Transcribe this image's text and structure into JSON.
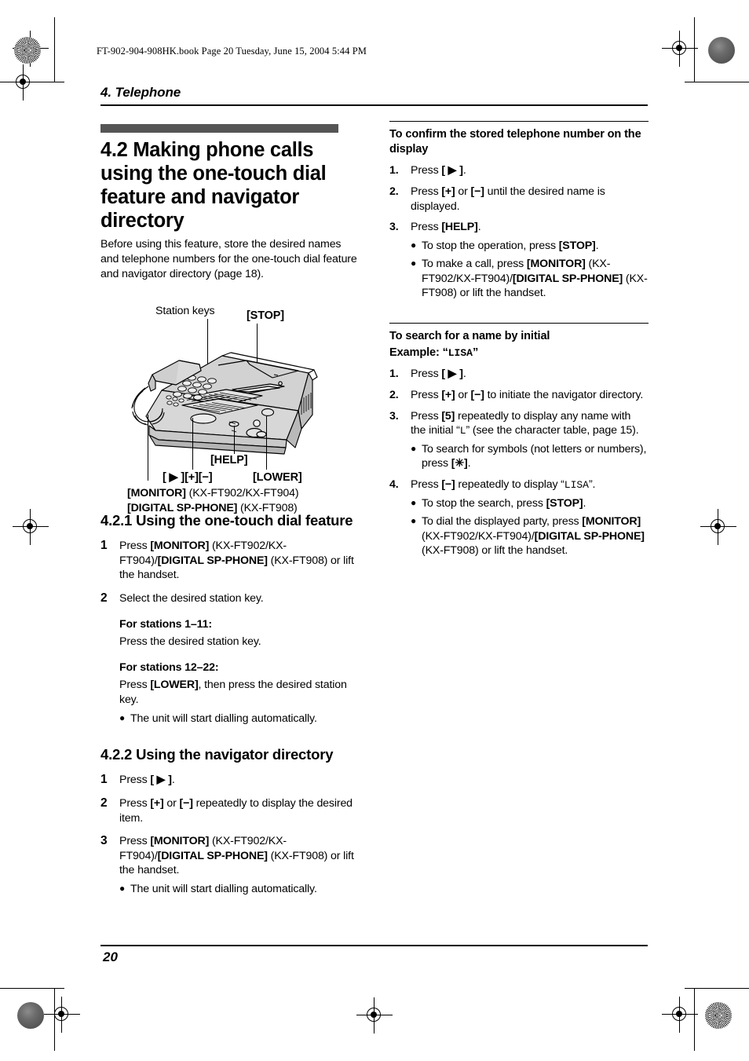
{
  "printer_marks": {
    "file_stamp": "FT-902-904-908HK.book  Page 20  Tuesday, June 15, 2004  5:44 PM"
  },
  "header": {
    "chapter": "4. Telephone"
  },
  "footer": {
    "page_number": "20"
  },
  "colors": {
    "section_band": "#555555",
    "rule": "#000000",
    "phone_body": "#d8d8d8",
    "phone_shadow": "#a9a9a9"
  },
  "left_column": {
    "section_title": "4.2 Making phone calls using the one-touch dial feature and navigator directory",
    "intro": "Before using this feature, store the desired names and telephone numbers for the one-touch dial feature and navigator directory (page 18).",
    "figure": {
      "label_station_keys": "Station keys",
      "label_stop": "[STOP]",
      "label_help": "[HELP]",
      "label_keys_row": "[ ▶ ][+][−]",
      "label_lower": "[LOWER]",
      "label_monitor_key": "[MONITOR]",
      "label_monitor_models": " (KX-FT902/KX-FT904)",
      "label_spphone_key": "[DIGITAL SP-PHONE]",
      "label_spphone_models": " (KX-FT908)"
    },
    "subsection_1": {
      "title": "4.2.1 Using the one-touch dial feature",
      "steps": [
        {
          "num": "1",
          "parts": [
            {
              "t": "Press ",
              "b": false
            },
            {
              "t": "[MONITOR]",
              "b": true
            },
            {
              "t": " (KX-FT902/KX-FT904)/",
              "b": false
            },
            {
              "t": "[DIGITAL SP-PHONE]",
              "b": true
            },
            {
              "t": " (KX-FT908) or lift the handset.",
              "b": false
            }
          ]
        },
        {
          "num": "2",
          "parts": [
            {
              "t": "Select the desired station key.",
              "b": false
            }
          ]
        }
      ],
      "stations_1_head": "For stations 1–11:",
      "stations_1_body": "Press the desired station key.",
      "stations_2_head": "For stations 12–22:",
      "stations_2_body_parts": [
        {
          "t": "Press ",
          "b": false
        },
        {
          "t": "[LOWER]",
          "b": true
        },
        {
          "t": ", then press the desired station key.",
          "b": false
        }
      ],
      "bullet": "The unit will start dialling automatically."
    },
    "subsection_2": {
      "title": "4.2.2 Using the navigator directory",
      "steps": [
        {
          "num": "1",
          "parts": [
            {
              "t": "Press ",
              "b": false
            },
            {
              "t": "[ ▶ ]",
              "b": true
            },
            {
              "t": ".",
              "b": false
            }
          ]
        },
        {
          "num": "2",
          "parts": [
            {
              "t": "Press ",
              "b": false
            },
            {
              "t": "[+]",
              "b": true
            },
            {
              "t": " or ",
              "b": false
            },
            {
              "t": "[−]",
              "b": true
            },
            {
              "t": " repeatedly to display the desired item.",
              "b": false
            }
          ]
        },
        {
          "num": "3",
          "parts": [
            {
              "t": "Press ",
              "b": false
            },
            {
              "t": "[MONITOR]",
              "b": true
            },
            {
              "t": " (KX-FT902/KX-FT904)/",
              "b": false
            },
            {
              "t": "[DIGITAL SP-PHONE]",
              "b": true
            },
            {
              "t": " (KX-FT908) or lift the handset.",
              "b": false
            }
          ]
        }
      ],
      "bullet": "The unit will start dialling automatically."
    }
  },
  "right_column": {
    "block_1": {
      "heading": "To confirm the stored telephone number on the display",
      "steps": [
        {
          "num": "1.",
          "parts": [
            {
              "t": "Press ",
              "b": false
            },
            {
              "t": "[ ▶ ]",
              "b": true
            },
            {
              "t": ".",
              "b": false
            }
          ],
          "bullets": []
        },
        {
          "num": "2.",
          "parts": [
            {
              "t": "Press ",
              "b": false
            },
            {
              "t": "[+]",
              "b": true
            },
            {
              "t": " or ",
              "b": false
            },
            {
              "t": "[−]",
              "b": true
            },
            {
              "t": " until the desired name is displayed.",
              "b": false
            }
          ],
          "bullets": []
        },
        {
          "num": "3.",
          "parts": [
            {
              "t": "Press ",
              "b": false
            },
            {
              "t": "[HELP]",
              "b": true
            },
            {
              "t": ".",
              "b": false
            }
          ],
          "bullets": [
            [
              {
                "t": "To stop the operation, press ",
                "b": false
              },
              {
                "t": "[STOP]",
                "b": true
              },
              {
                "t": ".",
                "b": false
              }
            ],
            [
              {
                "t": "To make a call, press ",
                "b": false
              },
              {
                "t": "[MONITOR]",
                "b": true
              },
              {
                "t": " (KX-FT902/KX-FT904)/",
                "b": false
              },
              {
                "t": "[DIGITAL SP-PHONE]",
                "b": true
              },
              {
                "t": " (KX-FT908) or lift the handset.",
                "b": false
              }
            ]
          ]
        }
      ]
    },
    "block_2": {
      "heading": "To search for a name by initial",
      "example_label": "Example: “",
      "example_value": "LISA",
      "example_close": "”",
      "steps": [
        {
          "num": "1.",
          "parts": [
            {
              "t": "Press ",
              "b": false
            },
            {
              "t": "[ ▶ ]",
              "b": true
            },
            {
              "t": ".",
              "b": false
            }
          ],
          "bullets": []
        },
        {
          "num": "2.",
          "parts": [
            {
              "t": "Press ",
              "b": false
            },
            {
              "t": "[+]",
              "b": true
            },
            {
              "t": " or ",
              "b": false
            },
            {
              "t": "[−]",
              "b": true
            },
            {
              "t": " to initiate the navigator directory.",
              "b": false
            }
          ],
          "bullets": []
        },
        {
          "num": "3.",
          "parts": [
            {
              "t": "Press ",
              "b": true,
              "only": "[5]"
            },
            {
              "t": "Press ",
              "b": false
            },
            {
              "t": "[5]",
              "b": true
            },
            {
              "t": " repeatedly to display any name with the initial “",
              "b": false
            },
            {
              "t": "L",
              "mono": true
            },
            {
              "t": "” (see the character table, page 15).",
              "b": false
            }
          ],
          "bullets": [
            [
              {
                "t": "To search for symbols (not letters or numbers), press ",
                "b": false
              },
              {
                "t": "[✳]",
                "b": true
              },
              {
                "t": ".",
                "b": false
              }
            ]
          ]
        },
        {
          "num": "4.",
          "parts": [
            {
              "t": "Press ",
              "b": false
            },
            {
              "t": "[−]",
              "b": true
            },
            {
              "t": " repeatedly to display “",
              "b": false
            },
            {
              "t": "LISA",
              "mono": true
            },
            {
              "t": "”.",
              "b": false
            }
          ],
          "bullets": [
            [
              {
                "t": "To stop the search, press ",
                "b": false
              },
              {
                "t": "[STOP]",
                "b": true
              },
              {
                "t": ".",
                "b": false
              }
            ],
            [
              {
                "t": "To dial the displayed party, press ",
                "b": false
              },
              {
                "t": "[MONITOR]",
                "b": true
              },
              {
                "t": " (KX-FT902/KX-FT904)/",
                "b": false
              },
              {
                "t": "[DIGITAL SP-PHONE]",
                "b": true
              },
              {
                "t": " (KX-FT908) or lift the handset.",
                "b": false
              }
            ]
          ]
        }
      ]
    }
  }
}
